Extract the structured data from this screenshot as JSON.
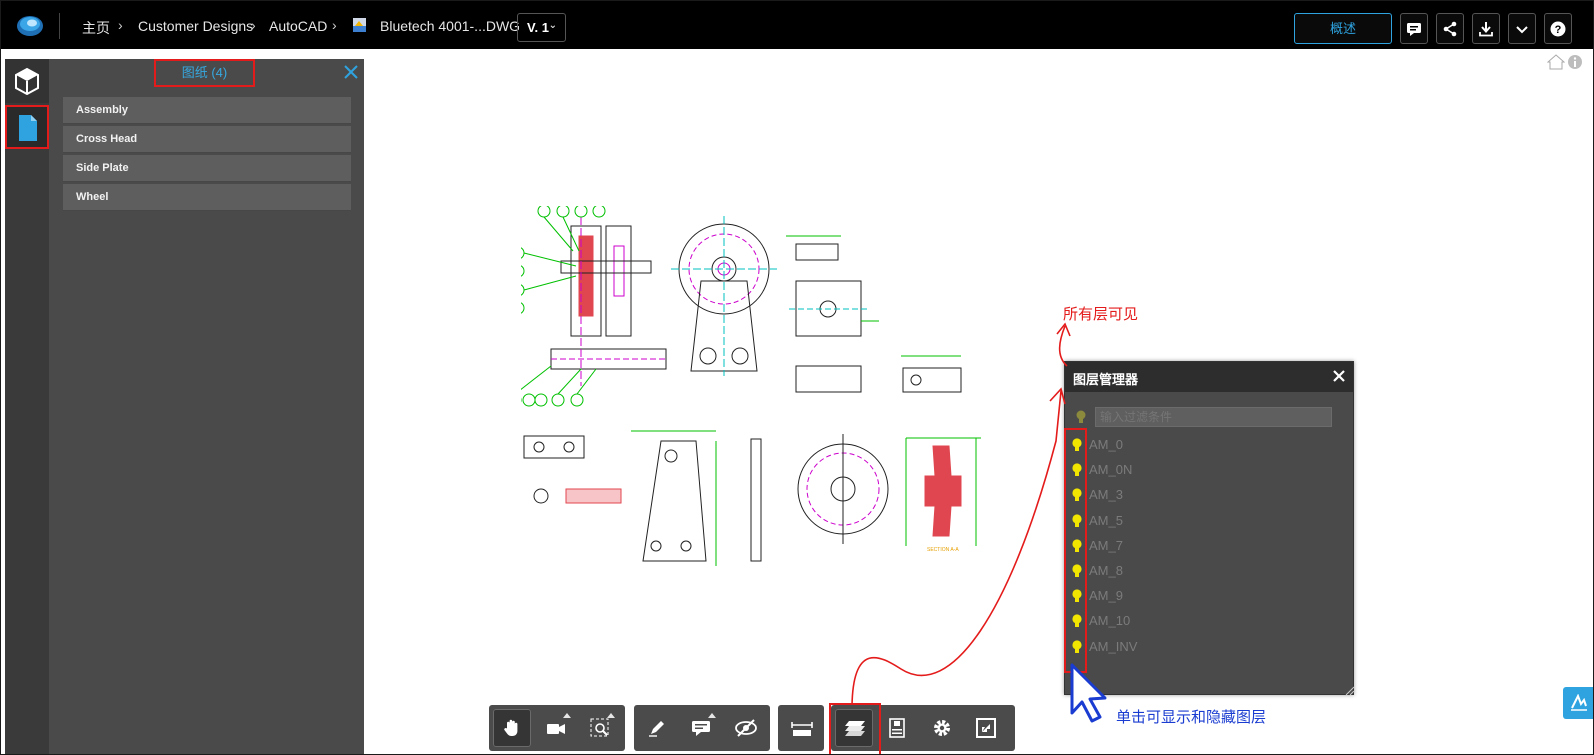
{
  "topbar": {
    "home": "主页",
    "crumbs": [
      "Customer Designs",
      "AutoCAD",
      "Bluetech 4001-...DWG"
    ],
    "version": "V. 1",
    "overview_button": "概述"
  },
  "sheets_panel": {
    "title": "图纸 (4)",
    "items": [
      {
        "label": "Assembly"
      },
      {
        "label": "Cross Head"
      },
      {
        "label": "Side Plate"
      },
      {
        "label": "Wheel"
      }
    ]
  },
  "layer_manager": {
    "title": "图层管理器",
    "filter_placeholder": "输入过滤条件",
    "layers": [
      {
        "name": "AM_0",
        "visible": true
      },
      {
        "name": "AM_0N",
        "visible": true
      },
      {
        "name": "AM_3",
        "visible": true
      },
      {
        "name": "AM_5",
        "visible": true
      },
      {
        "name": "AM_7",
        "visible": true
      },
      {
        "name": "AM_8",
        "visible": true
      },
      {
        "name": "AM_9",
        "visible": true
      },
      {
        "name": "AM_10",
        "visible": true
      },
      {
        "name": "AM_INV",
        "visible": true
      }
    ]
  },
  "annotations": {
    "all_visible": "所有层可见",
    "click_toggle": "单击可显示和隐藏图层"
  },
  "drawing": {
    "section_label": "SECTION A-A",
    "balloons": [
      "10",
      "13",
      "14",
      "11",
      "10",
      "7",
      "12",
      "8",
      "3",
      "4",
      "6",
      "5",
      "9"
    ]
  },
  "icons": {
    "topbar": [
      "comment-icon",
      "share-icon",
      "download-icon",
      "chevron-down-icon",
      "help-icon"
    ],
    "toolbar": [
      "pan-icon",
      "camera-icon",
      "zoom-window-icon",
      "markup-pen-icon",
      "comment-icon",
      "hide-icon",
      "measure-icon",
      "layers-icon",
      "properties-icon",
      "settings-icon",
      "fullscreen-icon"
    ]
  },
  "colors": {
    "accent": "#2ea3e0",
    "highlight": "#e41b1b",
    "bulb_on": "#f2e600",
    "annotation_blue": "#1a3cd1"
  }
}
